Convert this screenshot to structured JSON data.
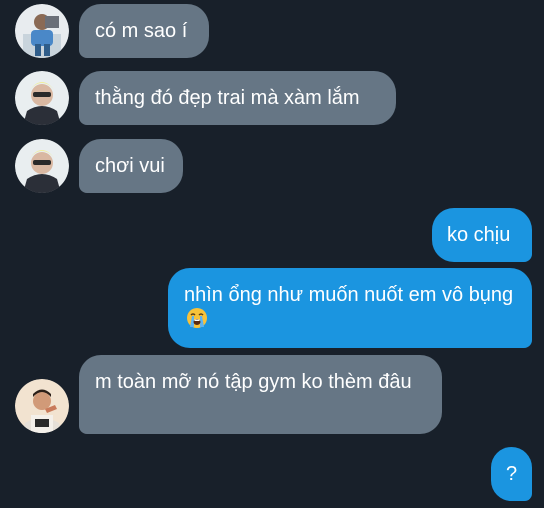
{
  "messages": [
    {
      "direction": "incoming",
      "sender_avatar": "user-avatar-1",
      "text": "có m sao í"
    },
    {
      "direction": "incoming",
      "sender_avatar": "user-avatar-2",
      "text": "thằng đó đẹp trai mà xàm lắm"
    },
    {
      "direction": "incoming",
      "sender_avatar": "user-avatar-2",
      "text": "chơi vui"
    },
    {
      "direction": "outgoing",
      "text": "ko chịu"
    },
    {
      "direction": "outgoing",
      "text": "nhìn ổng như muốn nuốt em vô bụng",
      "emoji": "loudly-crying-face-icon"
    },
    {
      "direction": "incoming",
      "sender_avatar": "user-avatar-3",
      "text": "m toàn mỡ nó tập gym ko thèm đâu"
    },
    {
      "direction": "outgoing",
      "text": "?"
    }
  ],
  "colors": {
    "background": "#18202a",
    "incoming_bubble": "#667685",
    "outgoing_bubble": "#1b95e0",
    "text": "#ffffff"
  }
}
